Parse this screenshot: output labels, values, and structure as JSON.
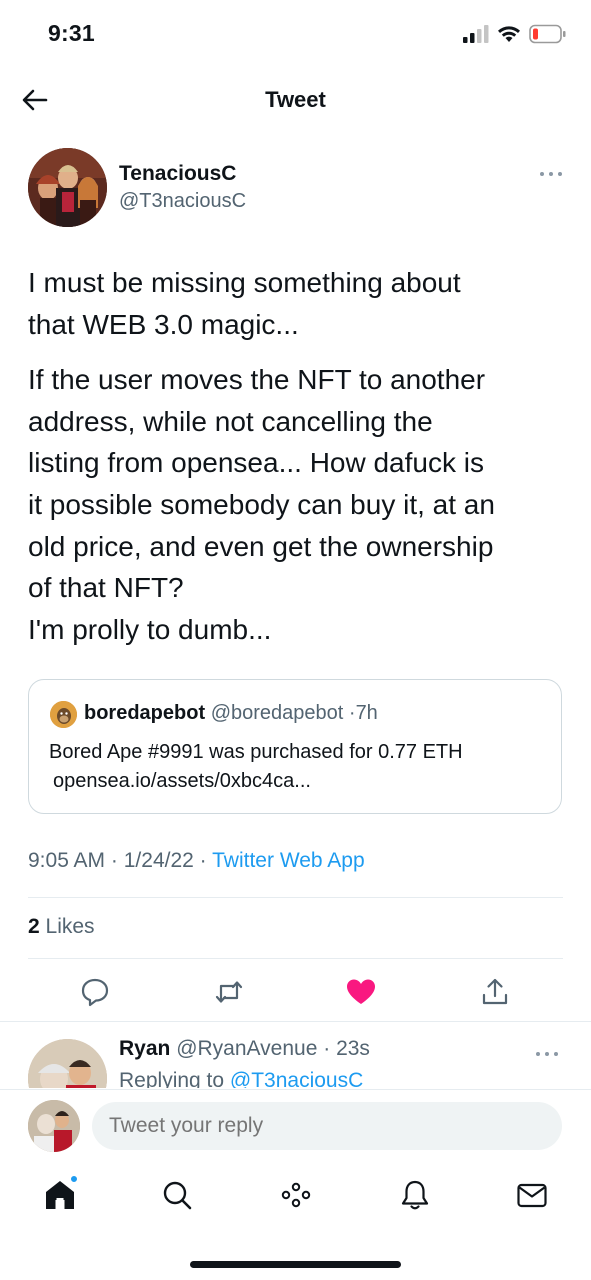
{
  "status_bar": {
    "time": "9:31"
  },
  "nav": {
    "title": "Tweet"
  },
  "tweet": {
    "author_name": "TenaciousC",
    "author_handle": "@T3naciousC",
    "paragraph_1": "I must be missing something about\nthat WEB 3.0 magic...",
    "paragraph_2": "If the user moves the NFT to another\naddress, while not cancelling the\nlisting from opensea... How dafuck is\nit possible somebody can buy it, at an\nold price, and even get the ownership\nof that NFT?\nI'm prolly to dumb...",
    "time": "9:05 AM",
    "date": "1/24/22",
    "source": "Twitter Web App",
    "likes_count": "2",
    "likes_label": "Likes"
  },
  "quote": {
    "name": "boredapebot",
    "handle": "@boredapebot",
    "age": "7h",
    "line_1": "Bored Ape #9991 was purchased for 0.77 ETH",
    "line_2": "opensea.io/assets/0xbc4ca..."
  },
  "reply": {
    "name": "Ryan",
    "handle": "@RyanAvenue",
    "age": "23s",
    "replying_prefix": "Replying to",
    "replying_to": "@T3naciousC"
  },
  "compose": {
    "placeholder": "Tweet your reply"
  },
  "colors": {
    "accent": "#1d9bf0",
    "like": "#f91880",
    "muted": "#536471",
    "text": "#0f1419"
  },
  "icons": {
    "actions": [
      "reply-icon",
      "retweet-icon",
      "like-icon-filled",
      "share-icon"
    ],
    "tabs": [
      "home-icon",
      "search-icon",
      "spaces-icon",
      "notifications-icon",
      "messages-icon"
    ]
  }
}
